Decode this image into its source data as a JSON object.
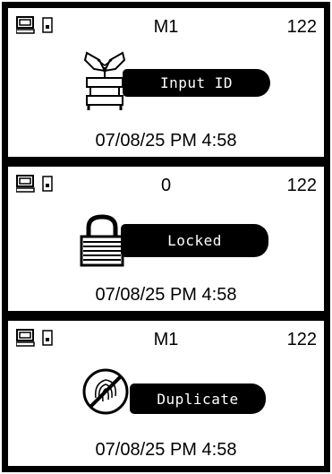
{
  "screens": [
    {
      "mode": "M1",
      "count": "122",
      "icon": "plant-hand-scan-icon",
      "message": "Input ID",
      "datetime": "07/08/25 PM 4:58"
    },
    {
      "mode": "0",
      "count": "122",
      "icon": "padlock-icon",
      "message": "Locked",
      "datetime": "07/08/25 PM 4:58"
    },
    {
      "mode": "M1",
      "count": "122",
      "icon": "no-fingerprint-icon",
      "message": "Duplicate",
      "datetime": "07/08/25 PM 4:58"
    }
  ],
  "status_icons": [
    "monitor-icon",
    "battery-icon"
  ],
  "colors": {
    "frame": "#000000",
    "screen": "#ffffff",
    "pill": "#000000",
    "pill_text": "#ffffff"
  }
}
